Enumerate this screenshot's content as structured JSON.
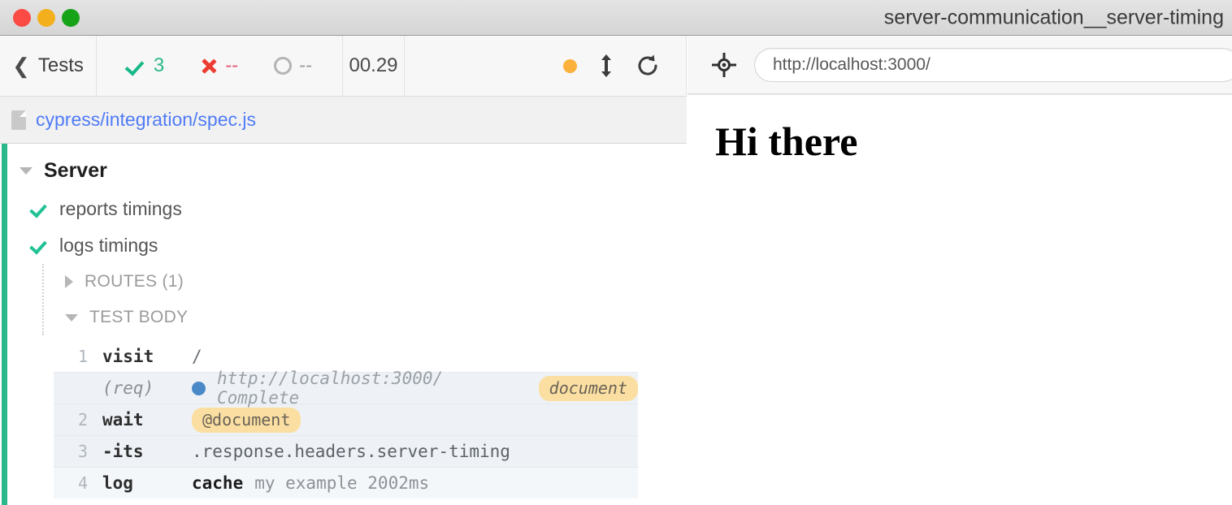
{
  "window": {
    "title": "server-communication__server-timing",
    "controls": [
      {
        "name": "close",
        "color": "#fc4b45"
      },
      {
        "name": "minimize",
        "color": "#f3b01c"
      },
      {
        "name": "zoom",
        "color": "#17a317"
      }
    ]
  },
  "reporter": {
    "back_label": "Tests",
    "stats": {
      "passed": "3",
      "failed": "--",
      "pending": "--"
    },
    "timer": "00.29",
    "controls": {
      "status_dot_color": "#fbb13c",
      "resize_label": "",
      "restart_label": ""
    },
    "spec_path": "cypress/integration/spec.js",
    "suite": {
      "name": "Server",
      "tests": [
        {
          "title": "reports timings",
          "state": "passed"
        },
        {
          "title": "logs timings",
          "state": "passed"
        }
      ]
    },
    "groups": [
      {
        "label": "ROUTES (1)",
        "expanded": false
      },
      {
        "label": "TEST BODY",
        "expanded": true
      }
    ],
    "commands": [
      {
        "number": "1",
        "name": "visit",
        "message": "/",
        "type": "command",
        "row": "white"
      },
      {
        "number": "",
        "name": "(req)",
        "message": "http://localhost:3000/ Complete",
        "badge": "document",
        "type": "request",
        "row": "shade"
      },
      {
        "number": "2",
        "name": "wait",
        "message": "",
        "badge": "@document",
        "type": "command",
        "row": "shade"
      },
      {
        "number": "3",
        "name": "-its",
        "message": ".response.headers.server-timing",
        "type": "command",
        "row": "shade"
      },
      {
        "number": "4",
        "name": "log",
        "message_strong": "cache",
        "message_dim": "my example 2002ms",
        "type": "command",
        "row": "shade2"
      }
    ]
  },
  "aut": {
    "url": "http://localhost:3000/",
    "url_placeholder": "http://localhost:3000/",
    "heading": "Hi there"
  },
  "colors": {
    "pass_green": "#2ab789",
    "fail_red": "#ed3c32",
    "pending_gray": "#b4b4b4",
    "link_blue": "#4f7bf7",
    "badge_amber": "#fbdfa2",
    "request_blue": "#4a89c8",
    "rail_green": "#2ab789"
  }
}
